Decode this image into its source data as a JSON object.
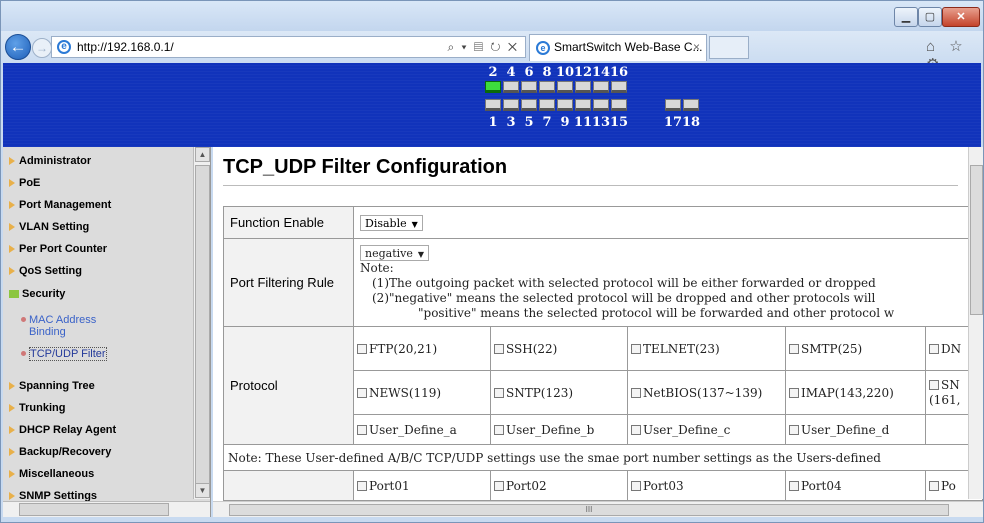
{
  "window": {
    "min": "▁",
    "max": "▢",
    "close": "✕"
  },
  "browser": {
    "url": "http://192.168.0.1/",
    "addr_tools": "⌕ ▾ ▤ ↻ ✕",
    "tab_title": "SmartSwitch Web-Base C...",
    "tab_close": "×",
    "nav_icons": "⌂ ☆ ⚙",
    "back": "←",
    "forward": "→"
  },
  "ports": {
    "top_labels": [
      "2",
      "4",
      "6",
      "8",
      "10",
      "12",
      "14",
      "16"
    ],
    "bottom_labels": [
      "1",
      "3",
      "5",
      "7",
      "9",
      "11",
      "13",
      "15",
      "17",
      "18"
    ],
    "active_ports": [
      "2"
    ]
  },
  "sidebar": {
    "items": [
      {
        "label": "Administrator"
      },
      {
        "label": "PoE"
      },
      {
        "label": "Port Management"
      },
      {
        "label": "VLAN Setting"
      },
      {
        "label": "Per Port Counter"
      },
      {
        "label": "QoS Setting"
      },
      {
        "label": "Security"
      },
      {
        "label": "Spanning Tree"
      },
      {
        "label": "Trunking"
      },
      {
        "label": "DHCP Relay Agent"
      },
      {
        "label": "Backup/Recovery"
      },
      {
        "label": "Miscellaneous"
      },
      {
        "label": "SNMP Settings"
      }
    ],
    "sub_items": [
      {
        "label": "MAC Address Binding"
      },
      {
        "label": "TCP/UDP Filter"
      }
    ]
  },
  "page": {
    "title": "TCP_UDP Filter Configuration",
    "function_enable_label": "Function Enable",
    "function_enable_value": "Disable",
    "port_filtering_label": "Port Filtering Rule",
    "port_filtering_value": "negative",
    "note_title": "Note:",
    "note_1": "(1)The outgoing packet with selected protocol will be either forwarded or dropped",
    "note_2": "(2)\"negative\" means the selected protocol will be dropped and other protocols will",
    "note_3": "\"positive\" means the selected protocol will be forwarded and other protocol w",
    "protocol_label": "Protocol",
    "protocols_row1": [
      "FTP(20,21)",
      "SSH(22)",
      "TELNET(23)",
      "SMTP(25)",
      "DN"
    ],
    "protocols_row2": [
      "NEWS(119)",
      "SNTP(123)",
      "NetBIOS(137~139)",
      "IMAP(143,220)",
      "SN"
    ],
    "protocols_row2_extra": "(161,",
    "protocols_row3": [
      "User_Define_a",
      "User_Define_b",
      "User_Define_c",
      "User_Define_d"
    ],
    "user_note": "Note: These User-defined A/B/C TCP/UDP settings use the smae port number settings as the Users-defined",
    "ports_row": [
      "Port01",
      "Port02",
      "Port03",
      "Port04",
      "Po"
    ]
  }
}
